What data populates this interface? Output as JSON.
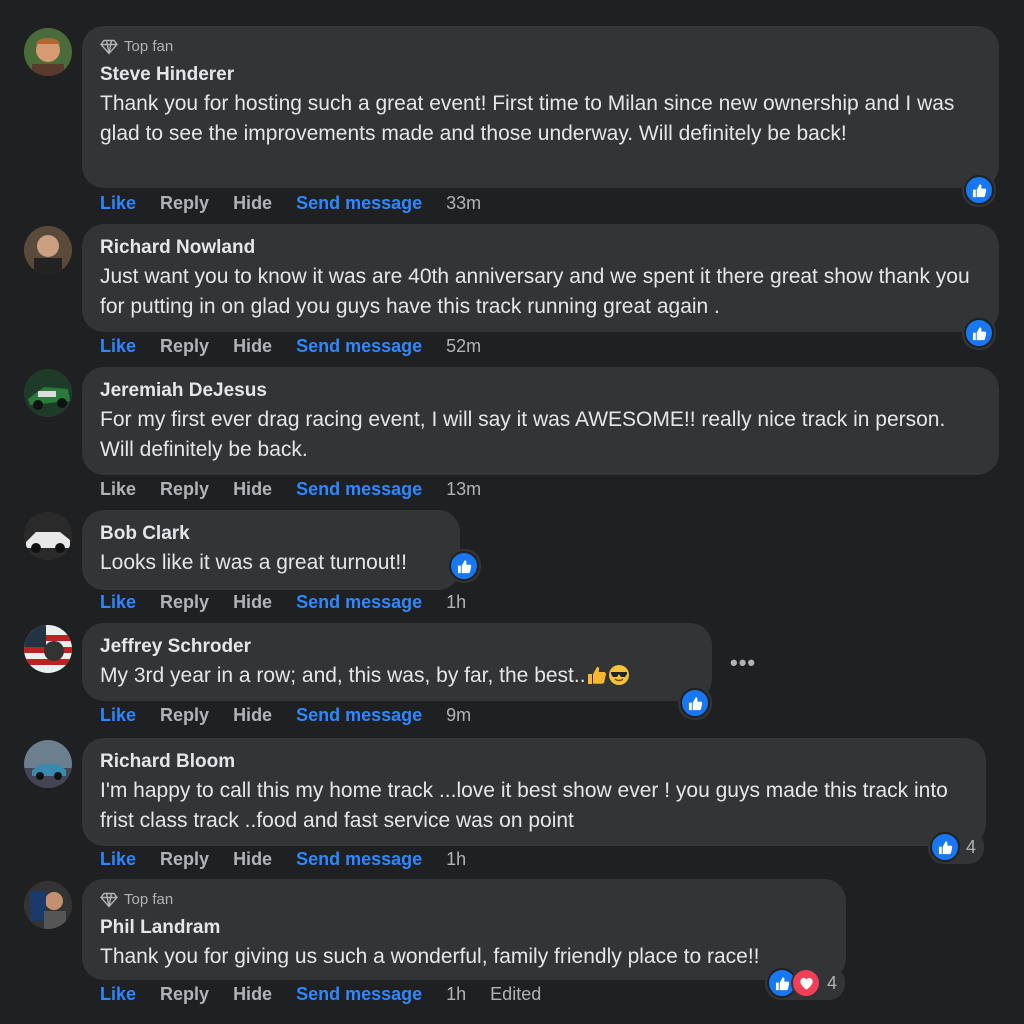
{
  "comments": [
    {
      "badge": "Top fan",
      "name": "Steve Hinderer",
      "text": "Thank you for hosting such a great event! First time to Milan since new ownership and I was glad to see the improvements made and those underway. Will definitely be back!",
      "actions": {
        "like": "Like",
        "reply": "Reply",
        "hide": "Hide",
        "send": "Send message",
        "time": "33m"
      }
    },
    {
      "name": "Richard Nowland",
      "text": "Just want you to know it was are 40th anniversary and we spent it there great show thank you for putting in on glad you guys have this track running great again .",
      "actions": {
        "like": "Like",
        "reply": "Reply",
        "hide": "Hide",
        "send": "Send message",
        "time": "52m"
      }
    },
    {
      "name": "Jeremiah DeJesus",
      "text": "For my first ever drag racing event, I will say it was AWESOME!! really nice track in person. Will definitely be back.",
      "actions": {
        "like": "Like",
        "reply": "Reply",
        "hide": "Hide",
        "send": "Send message",
        "time": "13m"
      }
    },
    {
      "name": "Bob Clark",
      "text": "Looks like it was a great turnout!!",
      "actions": {
        "like": "Like",
        "reply": "Reply",
        "hide": "Hide",
        "send": "Send message",
        "time": "1h"
      }
    },
    {
      "name": "Jeffrey Schroder",
      "text": "My 3rd year in a row; and, this was, by far, the best..",
      "actions": {
        "like": "Like",
        "reply": "Reply",
        "hide": "Hide",
        "send": "Send message",
        "time": "9m"
      },
      "more": "•••"
    },
    {
      "name": "Richard Bloom",
      "text": "I'm happy to call this my home track ...love it best show ever ! you guys made this track into frist class track ..food and fast service was on point",
      "actions": {
        "like": "Like",
        "reply": "Reply",
        "hide": "Hide",
        "send": "Send message",
        "time": "1h"
      },
      "reaction_count": "4"
    },
    {
      "badge": "Top fan",
      "name": "Phil Landram",
      "text": "Thank you for giving us such a wonderful, family friendly place to race!!",
      "actions": {
        "like": "Like",
        "reply": "Reply",
        "hide": "Hide",
        "send": "Send message",
        "time": "1h",
        "edited": "Edited"
      },
      "reaction_count": "4"
    }
  ],
  "colors": {
    "background": "#1f2021",
    "bubble": "#333435",
    "link": "#2d88ff",
    "like": "#1877f2",
    "heart": "#f33e58"
  }
}
